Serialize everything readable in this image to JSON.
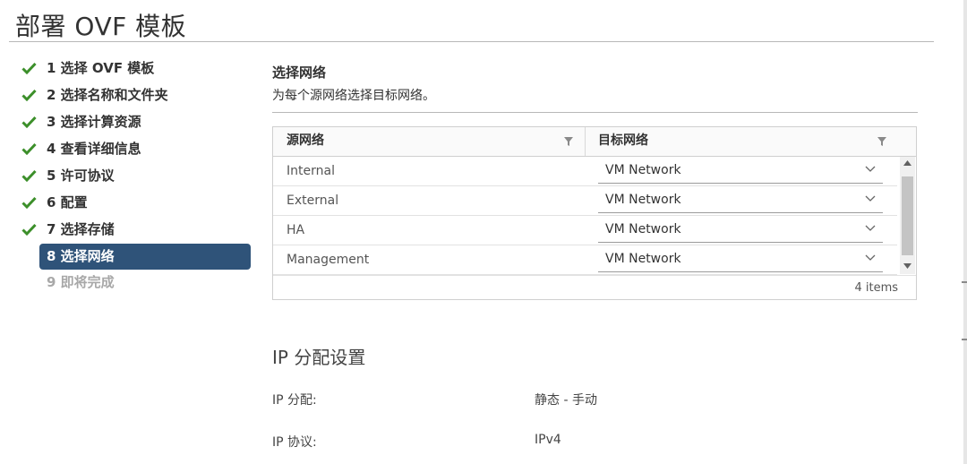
{
  "page": {
    "title": "部署 OVF 模板"
  },
  "steps": [
    {
      "label": "1 选择 OVF 模板",
      "state": "done"
    },
    {
      "label": "2 选择名称和文件夹",
      "state": "done"
    },
    {
      "label": "3 选择计算资源",
      "state": "done"
    },
    {
      "label": "4 查看详细信息",
      "state": "done"
    },
    {
      "label": "5 许可协议",
      "state": "done"
    },
    {
      "label": "6 配置",
      "state": "done"
    },
    {
      "label": "7 选择存储",
      "state": "done"
    },
    {
      "label": "8 选择网络",
      "state": "active"
    },
    {
      "label": "9 即将完成",
      "state": "pending"
    }
  ],
  "network": {
    "title": "选择网络",
    "description": "为每个源网络选择目标网络。",
    "columns": {
      "source": "源网络",
      "destination": "目标网络"
    },
    "rows": [
      {
        "source": "Internal",
        "destination": "VM Network"
      },
      {
        "source": "External",
        "destination": "VM Network"
      },
      {
        "source": "HA",
        "destination": "VM Network"
      },
      {
        "source": "Management",
        "destination": "VM Network"
      }
    ],
    "footer": "4 items"
  },
  "ip_settings": {
    "title": "IP 分配设置",
    "allocation_label": "IP 分配:",
    "allocation_value": "静态 - 手动",
    "protocol_label": "IP 协议:",
    "protocol_value": "IPv4"
  },
  "colors": {
    "active_step_bg": "#2f5379",
    "check_green": "#3c8f2a"
  },
  "icons": {
    "step_done": "check-icon",
    "column_filter": "filter-icon",
    "select": "chevron-down-icon"
  }
}
